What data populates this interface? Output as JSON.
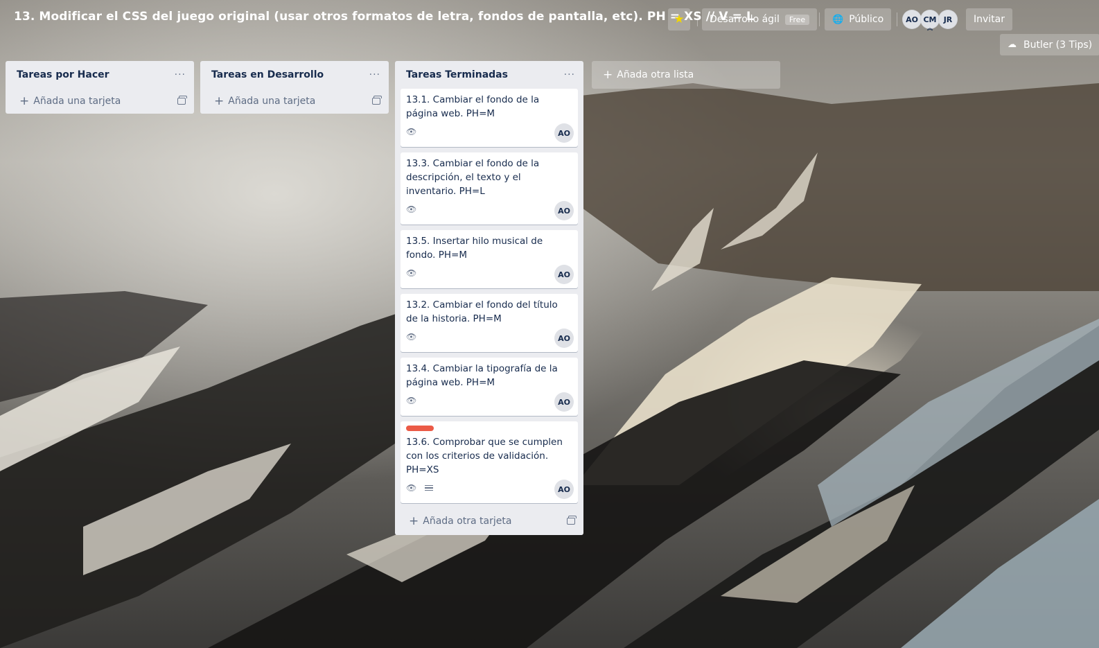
{
  "board": {
    "title": "13. Modificar el CSS del juego original (usar otros formatos de letra, fondos de pantalla, etc). PH = XS // V = L",
    "star_icon": "★",
    "team_name": "Desarrollo ágil",
    "team_badge": "Free",
    "visibility": "Público",
    "members": [
      "AO",
      "CM",
      "JR"
    ],
    "invite_label": "Invitar",
    "butler_label": "Butler (3 Tips)"
  },
  "lists": [
    {
      "title": "Tareas por Hacer",
      "add_card_label": "Añada una tarjeta",
      "cards": []
    },
    {
      "title": "Tareas en Desarrollo",
      "add_card_label": "Añada una tarjeta",
      "cards": []
    },
    {
      "title": "Tareas Terminadas",
      "add_card_label": "Añada otra tarjeta",
      "cards": [
        {
          "title": "13.1. Cambiar el fondo de la página web. PH=M",
          "member": "AO",
          "watching": true,
          "has_description": false,
          "label_color": null
        },
        {
          "title": "13.3. Cambiar el fondo de la descripción, el texto y el inventario. PH=L",
          "member": "AO",
          "watching": true,
          "has_description": false,
          "label_color": null
        },
        {
          "title": "13.5. Insertar hilo musical de fondo. PH=M",
          "member": "AO",
          "watching": true,
          "has_description": false,
          "label_color": null
        },
        {
          "title": "13.2. Cambiar el fondo del título de la historia. PH=M",
          "member": "AO",
          "watching": true,
          "has_description": false,
          "label_color": null
        },
        {
          "title": "13.4. Cambiar la tipografía de la página web. PH=M",
          "member": "AO",
          "watching": true,
          "has_description": false,
          "label_color": null
        },
        {
          "title": "13.6. Comprobar que se cumplen con los criterios de validación. PH=XS",
          "member": "AO",
          "watching": true,
          "has_description": true,
          "label_color": "#eb5a46"
        }
      ]
    }
  ],
  "add_list_label": "Añada otra lista",
  "icons": {
    "menu": "···",
    "plus": "+",
    "eye": "👁",
    "globe": "🌐",
    "bell": "☁"
  },
  "colors": {
    "list_bg": "#ebecf0",
    "label_red": "#eb5a46",
    "star": "#f2d600"
  }
}
